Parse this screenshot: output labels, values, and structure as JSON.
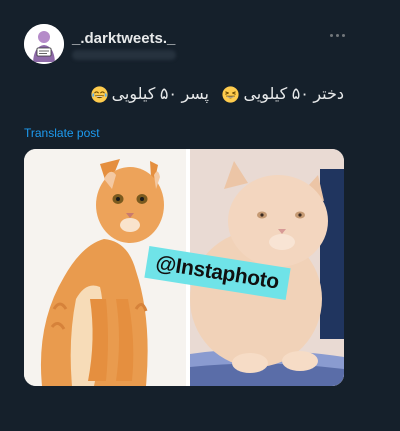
{
  "account": {
    "username": "_.darktweets._"
  },
  "tweet": {
    "text_part_1": "دختر ۵۰ کیلویی",
    "text_part_2": "پسر ۵۰ کیلویی",
    "emoji_1": "grinning-squint-face-emoji",
    "emoji_2": "face-with-tears-of-joy-emoji"
  },
  "translate_link": "Translate post",
  "media": {
    "watermark": "@Instaphoto",
    "left_photo": "slim orange tabby cat sitting",
    "right_photo": "fat cream cat sitting"
  },
  "colors": {
    "background": "#15202b",
    "text": "#e7e9ea",
    "link": "#1d9bf0",
    "muted": "#71767b",
    "watermark_bg": "#6fe3e8"
  }
}
